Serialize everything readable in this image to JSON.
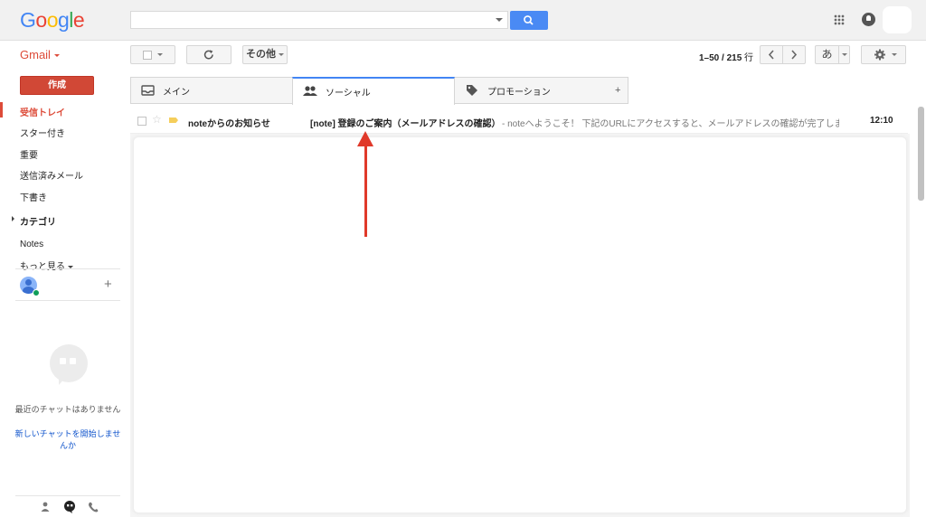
{
  "header": {
    "logo_letters": [
      "G",
      "o",
      "o",
      "g",
      "l",
      "e"
    ],
    "search_placeholder": ""
  },
  "toolbar": {
    "gmail_label": "Gmail",
    "more_label": "その他",
    "range_text": "1–50 / 215",
    "range_unit": "行",
    "input_tool_label": "あ"
  },
  "sidebar": {
    "compose_label": "作成",
    "items": [
      {
        "label": "受信トレイ",
        "active": true
      },
      {
        "label": "スター付き"
      },
      {
        "label": "重要"
      },
      {
        "label": "送信済みメール"
      },
      {
        "label": "下書き"
      }
    ],
    "categories_label": "カテゴリ",
    "notes_label": "Notes",
    "more_label": "もっと見る",
    "chat_empty": "最近のチャットはありません",
    "chat_start": "新しいチャットを開始しませんか"
  },
  "tabs": [
    {
      "label": "メイン",
      "icon": "inbox-icon"
    },
    {
      "label": "ソーシャル",
      "icon": "people-icon",
      "selected": true
    },
    {
      "label": "プロモーション",
      "icon": "tag-icon"
    }
  ],
  "messages": [
    {
      "sender": "noteからのお知らせ",
      "subject": "[note] 登録のご案内（メールアドレスの確認）",
      "snippet": "- noteへようこそ！ 下記のURLにアクセスすると、メールアドレスの確認が完了しま",
      "time": "12:10"
    }
  ],
  "colors": {
    "accent_red": "#dd4b39",
    "search_blue": "#4a8af4",
    "annotation_arrow": "#e0392a"
  }
}
